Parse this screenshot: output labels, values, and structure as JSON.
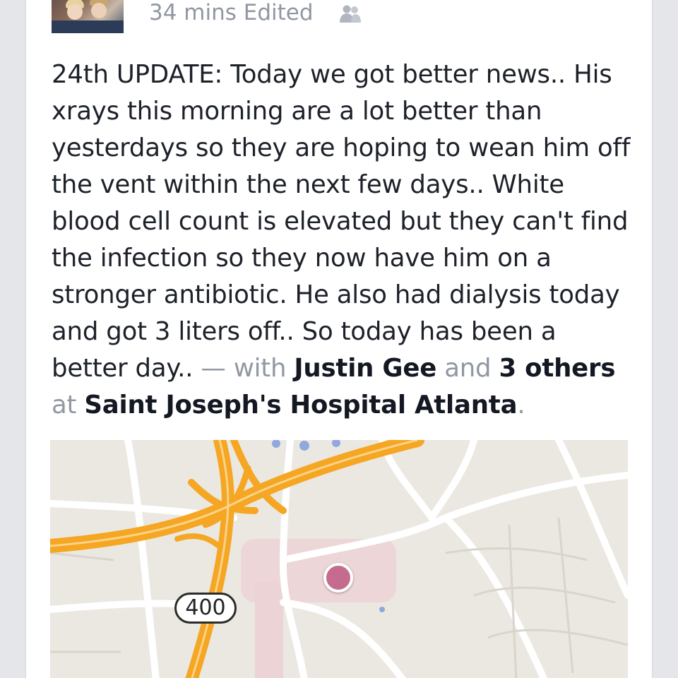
{
  "post": {
    "timestamp": "34 mins Edited",
    "audience_icon": "friends-icon",
    "text_main": "24th UPDATE: Today we got better news.. His xrays this morning are a lot better than yesterdays so they are hoping to wean him off the vent within the next few days.. White blood cell count is elevated but they can't find the infection so they now have him on a stronger antibiotic. He also had dialysis today and got 3 liters off.. So today has been a better day..",
    "with_sep": " — with ",
    "tagged_person": "Justin Gee",
    "and_word": " and ",
    "others_link": "3 others",
    "at_word": " at ",
    "place": "Saint Joseph's Hospital Atlanta",
    "period": "."
  },
  "map": {
    "route_shield": "400",
    "pin_color": "#c56c8e",
    "highway_color": "#f5a623"
  }
}
